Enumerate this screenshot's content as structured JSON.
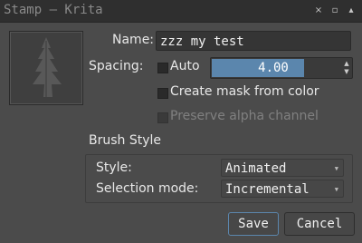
{
  "window": {
    "title": "Stamp — Krita",
    "close_glyph": "×",
    "restore_glyph": "▫",
    "shade_glyph": "▴"
  },
  "form": {
    "name_label": "Name:",
    "name_value": "zzz my test",
    "spacing_label": "Spacing:",
    "auto_label": "Auto",
    "spacing_value": "4.00",
    "spacing_fill_fraction": 0.74,
    "create_mask_label": "Create mask from color",
    "preserve_alpha_label": "Preserve alpha channel",
    "auto_checked": false,
    "create_mask_checked": false,
    "preserve_alpha_checked": false,
    "preserve_alpha_enabled": false
  },
  "brush_style": {
    "title": "Brush Style",
    "style_label": "Style:",
    "style_value": "Animated",
    "selection_mode_label": "Selection mode:",
    "selection_mode_value": "Incremental"
  },
  "buttons": {
    "save": "Save",
    "cancel": "Cancel"
  },
  "colors": {
    "accent": "#5b86ad",
    "background": "#4b4b4b",
    "titlebar": "#2f2f2f"
  }
}
